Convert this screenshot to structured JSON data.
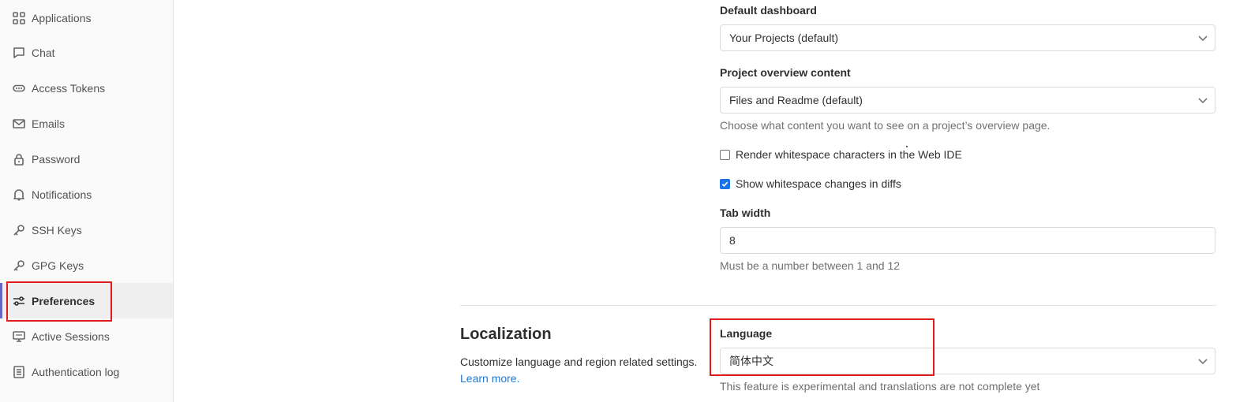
{
  "sidebar": {
    "items": [
      {
        "label": "Applications",
        "icon": "applications-icon"
      },
      {
        "label": "Chat",
        "icon": "chat-icon"
      },
      {
        "label": "Access Tokens",
        "icon": "token-icon"
      },
      {
        "label": "Emails",
        "icon": "mail-icon"
      },
      {
        "label": "Password",
        "icon": "lock-icon"
      },
      {
        "label": "Notifications",
        "icon": "bell-icon"
      },
      {
        "label": "SSH Keys",
        "icon": "key-icon"
      },
      {
        "label": "GPG Keys",
        "icon": "key-icon"
      },
      {
        "label": "Preferences",
        "icon": "preferences-icon",
        "active": true
      },
      {
        "label": "Active Sessions",
        "icon": "monitor-icon"
      },
      {
        "label": "Authentication log",
        "icon": "log-icon"
      }
    ]
  },
  "behavior": {
    "default_dashboard_label": "Default dashboard",
    "default_dashboard_value": "Your Projects (default)",
    "project_overview_label": "Project overview content",
    "project_overview_value": "Files and Readme (default)",
    "project_overview_help": "Choose what content you want to see on a project’s overview page.",
    "render_whitespace_label": "Render whitespace characters in the Web IDE",
    "render_whitespace_checked": false,
    "show_whitespace_label": "Show whitespace changes in diffs",
    "show_whitespace_checked": true,
    "tab_width_label": "Tab width",
    "tab_width_value": "8",
    "tab_width_help": "Must be a number between 1 and 12"
  },
  "localization": {
    "title": "Localization",
    "description": "Customize language and region related settings.",
    "learn_more": "Learn more.",
    "language_label": "Language",
    "language_value": "简体中文",
    "language_help": "This feature is experimental and translations are not complete yet"
  },
  "colors": {
    "active_bar": "#6666c4",
    "highlight": "#e01b1b",
    "link": "#1f78d1",
    "checkbox": "#1a73e8"
  }
}
